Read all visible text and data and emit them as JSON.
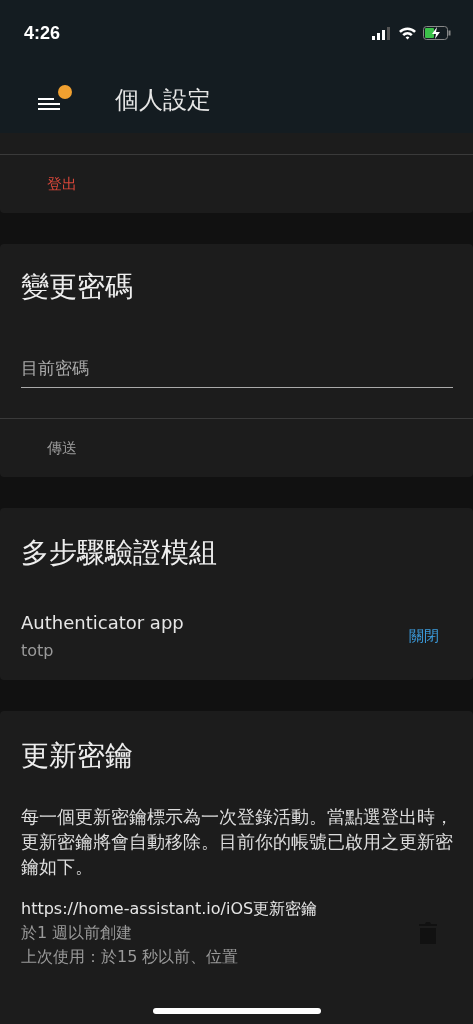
{
  "status_bar": {
    "time": "4:26"
  },
  "header": {
    "title": "個人設定",
    "menu_badge": true
  },
  "logout_card": {
    "button": "登出"
  },
  "password_card": {
    "title": "變更密碼",
    "field": {
      "placeholder": "目前密碼"
    },
    "button": "傳送"
  },
  "mfa_card": {
    "title": "多步驟驗證模組",
    "modules": [
      {
        "name": "Authenticator app",
        "id": "totp",
        "action": "關閉"
      }
    ]
  },
  "refresh_card": {
    "title": "更新密鑰",
    "description": "每一個更新密鑰標示為一次登錄活動。當點選登出時，更新密鑰將會自動移除。目前你的帳號已啟用之更新密鑰如下。",
    "tokens": [
      {
        "name": "https://home-assistant.io/iOS更新密鑰",
        "created": "於1 週以前創建",
        "last_used": "上次使用：於15 秒以前、位置"
      }
    ]
  }
}
